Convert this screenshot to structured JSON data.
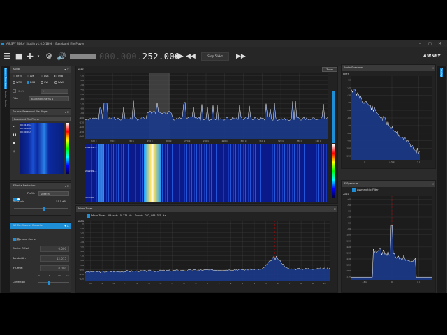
{
  "app": {
    "title": "AIRSPY SDR# Studio v1.0.0.1898 - Baseband File Player",
    "logo": "AIRSPY"
  },
  "toolbar": {
    "frequency_dim": "000.000.",
    "frequency_bright": "252.000",
    "step_label": "Step 5 kHz"
  },
  "left_tabs": [
    "Source Baseband",
    "Audio",
    "Radio",
    "Noise",
    "Plugins"
  ],
  "right_tabs": [
    "Display"
  ],
  "radio": {
    "title": "Radio",
    "modes": [
      {
        "label": "NFM",
        "selected": false
      },
      {
        "label": "AM",
        "selected": false
      },
      {
        "label": "LSB",
        "selected": false
      },
      {
        "label": "USB",
        "selected": false
      },
      {
        "label": "WFM",
        "selected": false
      },
      {
        "label": "DSB",
        "selected": true
      },
      {
        "label": "CW",
        "selected": false
      },
      {
        "label": "RAW",
        "selected": false
      }
    ],
    "shift_label": "Shift",
    "filter_label": "Filter",
    "filter_value": "Blackman-Harris 4"
  },
  "source": {
    "title": "Source: Baseband File Player",
    "file_label": "Baseband File Player",
    "times": [
      "00:01:09.4",
      "00:00:00.0",
      "00:00:05.5"
    ]
  },
  "if_noise": {
    "title": "IF Noise Reduction",
    "profile_label": "Profile",
    "profile_value": "Speech",
    "threshold_label": "Threshold",
    "threshold_value": "-51.5 dB",
    "threshold_level": 0.55
  },
  "cochannel": {
    "title": "AM Co-Channel Canceller",
    "remove_carrier": "Remove Carrier",
    "fields": [
      {
        "label": "Carrier Offset",
        "value": "0.000"
      },
      {
        "label": "Bandwidth",
        "value": "12.075"
      },
      {
        "label": "IF Offset",
        "value": "0.000"
      }
    ],
    "correction_label": "Correction",
    "correction_ticks": [
      "0",
      "5",
      "10",
      "15"
    ],
    "correction_level": 0.35
  },
  "spectrum": {
    "unit": "dBFS",
    "zoom": "Zoom",
    "y_ticks": [
      "-10",
      "-20",
      "-30",
      "-40",
      "-50",
      "-60",
      "-70",
      "-80",
      "-90",
      "-100",
      "-110",
      "-120",
      "-130",
      "-140"
    ],
    "x_ticks": [
      "220 k",
      "230 k",
      "240 k",
      "250 k",
      "260 k",
      "270 k",
      "280 k",
      "290 k",
      "300 k",
      "310 k",
      "320 k",
      "330 k",
      "340 k"
    ],
    "waterfall_times": [
      "2022-09-...",
      "2022-09-...",
      "2022-09-..."
    ]
  },
  "micro_tuner": {
    "title": "Micro Tuner",
    "checkbox": "Micro Tuner",
    "offset_label": "Offset:",
    "offset_value": "5.375 Hz",
    "tuned_label": "Tuned:",
    "tuned_value": "252,005.375 Hz",
    "unit": "dBFS",
    "y_ticks": [
      "0",
      "-10",
      "-20",
      "-30",
      "-40",
      "-50",
      "-60",
      "-70",
      "-80",
      "-90",
      "-100",
      "-110",
      "-120"
    ],
    "x_ticks": [
      "-10",
      "-9",
      "-8",
      "-7",
      "-6",
      "-5",
      "-4",
      "-3",
      "-2",
      "-1",
      "0",
      "1",
      "2",
      "3",
      "4",
      "5",
      "6",
      "7",
      "8",
      "9",
      "10"
    ]
  },
  "audio_spectrum": {
    "title": "Audio Spectrum",
    "unit": "dBFS",
    "y_ticks": [
      "-10",
      "-20",
      "-30",
      "-40",
      "-50",
      "-60",
      "-70",
      "-80",
      "-90",
      "-100",
      "-110"
    ],
    "x_ticks": [
      "0",
      "2.5 k",
      "5 k"
    ]
  },
  "if_spectrum": {
    "title": "IF Spectrum",
    "checkbox": "Asymmetric Filter",
    "unit": "dBFS",
    "y_ticks": [
      "-40",
      "-50",
      "-60",
      "-70",
      "-80",
      "-90",
      "-100",
      "-110",
      "-120",
      "-130",
      "-140",
      "-150",
      "-160",
      "-170"
    ],
    "x_ticks": [
      "-6 k",
      "0",
      "6 k"
    ]
  },
  "colors": {
    "accent": "#1e8fd6",
    "spectrum_fill": "#1a3a8a",
    "waterfall_bg": "#0a1a8a"
  }
}
